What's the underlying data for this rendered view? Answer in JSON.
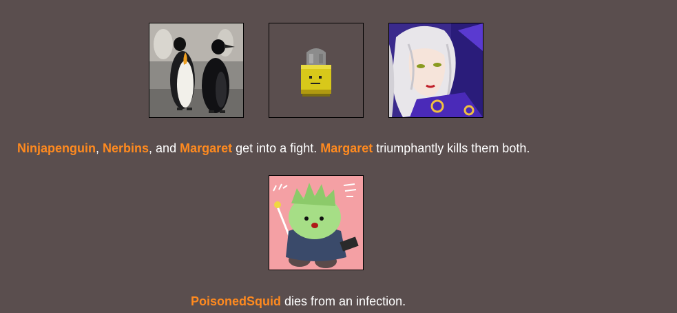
{
  "event1": {
    "tributes": [
      {
        "name": "Ninjapenguin",
        "image": "penguins-avatar"
      },
      {
        "name": "Nerbins",
        "image": "bullet-avatar"
      },
      {
        "name": "Margaret",
        "image": "anime-woman-avatar"
      }
    ],
    "sep1": ", ",
    "sep2": ", and ",
    "text1": " get into a fight. ",
    "killer": "Margaret",
    "text2": " triumphantly kills them both."
  },
  "event2": {
    "tributes": [
      {
        "name": "PoisonedSquid",
        "image": "green-blob-doodle-avatar"
      }
    ],
    "text": " dies from an infection."
  },
  "colors": {
    "background": "#5a4e4e",
    "name": "#ff8a1f",
    "text": "#ffffff"
  }
}
